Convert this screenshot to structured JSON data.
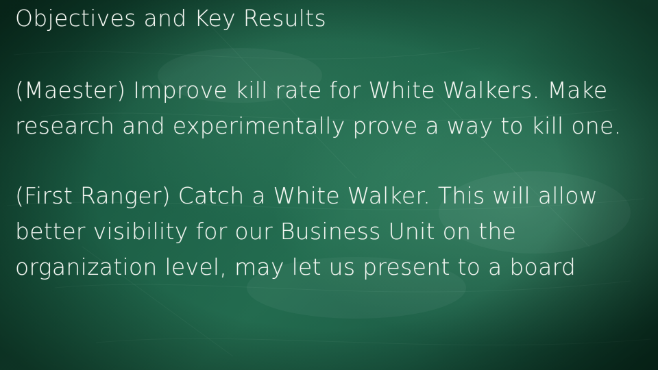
{
  "slide": {
    "title": "Objectives and Key Results",
    "paragraphs": [
      "(Maester) Improve kill rate for White Walkers. Make research and experimentally prove a way to kill one.",
      "(First Ranger) Catch a White Walker. This will allow better visibility for our Business Unit on the organization level, may let us present to a board"
    ]
  },
  "colors": {
    "board_green": "#1a5a42",
    "chalk_white": "#f4f7f2"
  }
}
